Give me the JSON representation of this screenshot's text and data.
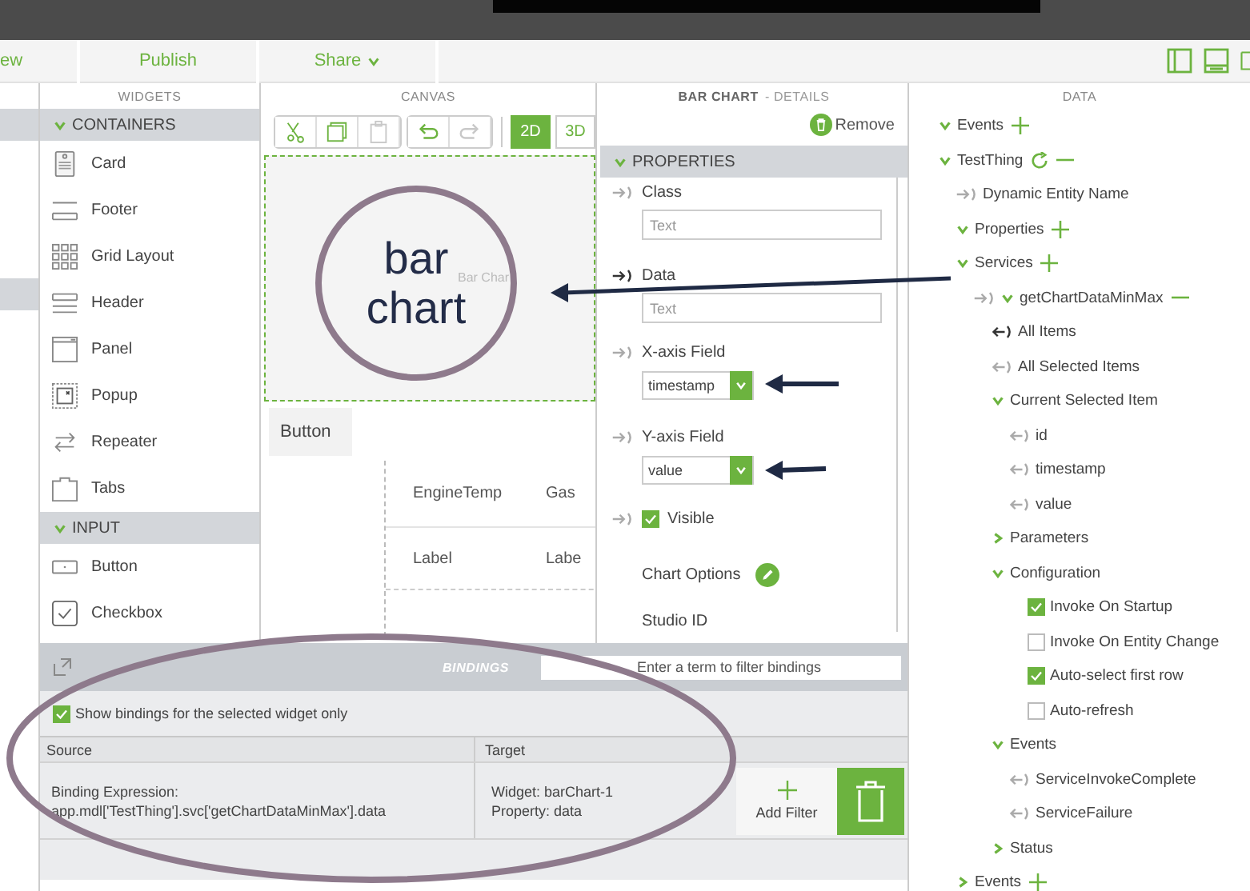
{
  "top_toolbar": {
    "items": [
      {
        "label": "ew",
        "dropdown": false
      },
      {
        "label": "Publish",
        "dropdown": false
      },
      {
        "label": "Share",
        "dropdown": true
      }
    ]
  },
  "widgets_panel": {
    "title": "WIDGETS",
    "sections": [
      {
        "title": "CONTAINERS",
        "expanded": true,
        "items": [
          {
            "label": "Card",
            "kind": "card"
          },
          {
            "label": "Footer",
            "kind": "footer"
          },
          {
            "label": "Grid Layout",
            "kind": "grid"
          },
          {
            "label": "Header",
            "kind": "header"
          },
          {
            "label": "Panel",
            "kind": "panel"
          },
          {
            "label": "Popup",
            "kind": "popup"
          },
          {
            "label": "Repeater",
            "kind": "repeater"
          },
          {
            "label": "Tabs",
            "kind": "tabs"
          }
        ]
      },
      {
        "title": "INPUT",
        "expanded": true,
        "items": [
          {
            "label": "Button",
            "kind": "button"
          },
          {
            "label": "Checkbox",
            "kind": "checkbox"
          }
        ]
      }
    ]
  },
  "canvas": {
    "title": "CANVAS",
    "tools": [
      {
        "kind": "cut",
        "disabled": false
      },
      {
        "kind": "copy",
        "disabled": false
      },
      {
        "kind": "paste",
        "disabled": true
      },
      {
        "kind": "undo",
        "disabled": false
      },
      {
        "kind": "redo",
        "disabled": true
      }
    ],
    "view_modes": [
      {
        "label": "2D",
        "selected": true
      },
      {
        "label": "3D",
        "selected": false
      }
    ],
    "chart_widget_label": "Bar Char",
    "button_label": "Button",
    "grid": {
      "headers": [
        "EngineTemp",
        "Gas"
      ],
      "cells": [
        "Label",
        "Labe"
      ]
    }
  },
  "details": {
    "title": "BAR CHART",
    "subtitle": "- DETAILS",
    "remove_label": "Remove",
    "section": {
      "title": "PROPERTIES",
      "expanded": true
    },
    "properties": [
      {
        "kind": "text",
        "label": "Class",
        "placeholder": "Text",
        "bound": false
      },
      {
        "kind": "text",
        "label": "Data",
        "placeholder": "Text",
        "bound": true
      },
      {
        "kind": "select",
        "label": "X-axis Field",
        "value": "timestamp",
        "bound": false
      },
      {
        "kind": "select",
        "label": "Y-axis Field",
        "value": "value",
        "bound": false
      },
      {
        "kind": "checkbox",
        "label": "Visible",
        "checked": true,
        "bound": false
      },
      {
        "kind": "edit",
        "label": "Chart Options"
      },
      {
        "kind": "plain",
        "label": "Studio ID"
      }
    ]
  },
  "data_panel": {
    "title": "DATA",
    "tree": [
      {
        "kind": "group",
        "label": "Events",
        "expanded": true,
        "addable": true
      },
      {
        "kind": "group",
        "label": "TestThing",
        "expanded": true,
        "refreshable": true,
        "removable": true,
        "children": [
          {
            "kind": "source",
            "label": "Dynamic Entity Name"
          },
          {
            "kind": "group",
            "label": "Properties",
            "expanded": true,
            "addable": true
          },
          {
            "kind": "group",
            "label": "Services",
            "expanded": true,
            "addable": true,
            "children": [
              {
                "kind": "service",
                "label": "getChartDataMinMax",
                "expanded": true,
                "removable": true,
                "children": [
                  {
                    "kind": "event",
                    "label": "All Items",
                    "bound": true
                  },
                  {
                    "kind": "event",
                    "label": "All Selected Items",
                    "bound": false
                  },
                  {
                    "kind": "group",
                    "label": "Current Selected Item",
                    "expanded": true,
                    "children": [
                      {
                        "kind": "event",
                        "label": "id",
                        "bound": false
                      },
                      {
                        "kind": "event",
                        "label": "timestamp",
                        "bound": false
                      },
                      {
                        "kind": "event",
                        "label": "value",
                        "bound": false
                      }
                    ]
                  },
                  {
                    "kind": "group",
                    "label": "Parameters",
                    "expanded": false
                  },
                  {
                    "kind": "group",
                    "label": "Configuration",
                    "expanded": true,
                    "children": [
                      {
                        "kind": "option",
                        "label": "Invoke On Startup",
                        "checked": true
                      },
                      {
                        "kind": "option",
                        "label": "Invoke On Entity Change",
                        "checked": false
                      },
                      {
                        "kind": "option",
                        "label": "Auto-select first row",
                        "checked": true
                      },
                      {
                        "kind": "option",
                        "label": "Auto-refresh",
                        "checked": false
                      }
                    ]
                  },
                  {
                    "kind": "group",
                    "label": "Events",
                    "expanded": true,
                    "children": [
                      {
                        "kind": "event",
                        "label": "ServiceInvokeComplete",
                        "bound": false
                      },
                      {
                        "kind": "event",
                        "label": "ServiceFailure",
                        "bound": false
                      }
                    ]
                  },
                  {
                    "kind": "group",
                    "label": "Status",
                    "expanded": false
                  }
                ]
              }
            ]
          },
          {
            "kind": "group",
            "label": "Events",
            "expanded": false,
            "addable": true
          }
        ]
      }
    ]
  },
  "bindings": {
    "title": "BINDINGS",
    "filter_placeholder": "Enter a term to filter bindings",
    "only_selected": {
      "label": "Show bindings for the selected widget only",
      "checked": true
    },
    "columns": [
      "Source",
      "Target"
    ],
    "rows": [
      {
        "source": [
          "Binding Expression:",
          "app.mdl['TestThing'].svc['getChartDataMinMax'].data"
        ],
        "target": [
          "Widget: barChart-1",
          "Property: data"
        ]
      }
    ],
    "add_filter_label": "Add Filter"
  },
  "annotations": {
    "circle_lines": [
      "bar",
      "chart"
    ]
  }
}
